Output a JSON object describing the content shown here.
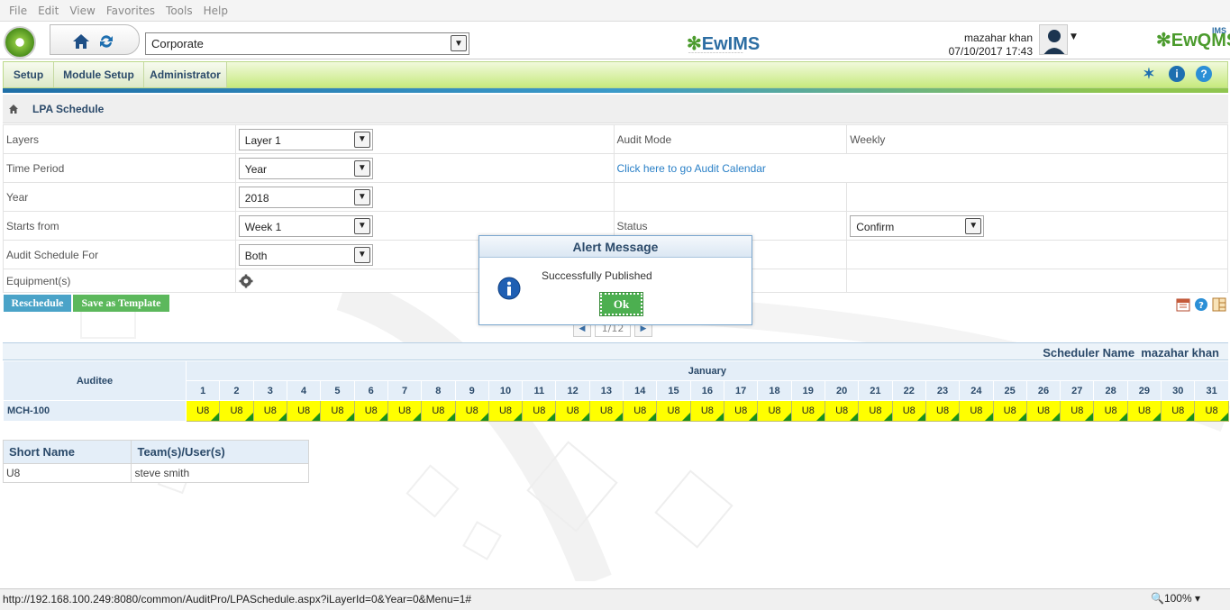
{
  "menu": [
    "File",
    "Edit",
    "View",
    "Favorites",
    "Tools",
    "Help"
  ],
  "header": {
    "org_select": "Corporate",
    "brand_center": "EwIMS",
    "brand_right": "EwQMS",
    "brand_right_super": "IMS",
    "user_name": "mazahar khan",
    "datetime": "07/10/2017 17:43"
  },
  "nav": {
    "tabs": [
      "Setup",
      "Module Setup",
      "Administrator"
    ]
  },
  "breadcrumb": {
    "title": "LPA Schedule"
  },
  "form": {
    "layers_label": "Layers",
    "layers_value": "Layer 1",
    "time_period_label": "Time Period",
    "time_period_value": "Year",
    "year_label": "Year",
    "year_value": "2018",
    "starts_from_label": "Starts from",
    "starts_from_value": "Week 1",
    "audit_schedule_for_label": "Audit Schedule For",
    "audit_schedule_for_value": "Both",
    "equipment_label": "Equipment(s)",
    "audit_mode_label": "Audit Mode",
    "audit_mode_value": "Weekly",
    "calendar_link": "Click here to go Audit Calendar",
    "status_label": "Status",
    "status_value": "Confirm"
  },
  "actions": {
    "reschedule": "Reschedule",
    "save_template": "Save as Template"
  },
  "pager": {
    "label": "1/12"
  },
  "scheduler": {
    "label": "Scheduler Name",
    "name": "mazahar khan"
  },
  "schedule": {
    "auditee_header": "Auditee",
    "month": "January",
    "days": [
      "1",
      "2",
      "3",
      "4",
      "5",
      "6",
      "7",
      "8",
      "9",
      "10",
      "11",
      "12",
      "13",
      "14",
      "15",
      "16",
      "17",
      "18",
      "19",
      "20",
      "21",
      "22",
      "23",
      "24",
      "25",
      "26",
      "27",
      "28",
      "29",
      "30",
      "31"
    ],
    "rows": [
      {
        "auditee": "MCH-100",
        "cells": [
          "U8",
          "U8",
          "U8",
          "U8",
          "U8",
          "U8",
          "U8",
          "U8",
          "U8",
          "U8",
          "U8",
          "U8",
          "U8",
          "U8",
          "U8",
          "U8",
          "U8",
          "U8",
          "U8",
          "U8",
          "U8",
          "U8",
          "U8",
          "U8",
          "U8",
          "U8",
          "U8",
          "U8",
          "U8",
          "U8",
          "U8"
        ]
      }
    ]
  },
  "legend": {
    "headers": [
      "Short Name",
      "Team(s)/User(s)"
    ],
    "rows": [
      [
        "U8",
        "steve smith"
      ]
    ]
  },
  "dialog": {
    "title": "Alert Message",
    "message": "Successfully Published",
    "ok": "Ok"
  },
  "statusbar": {
    "url": "http://192.168.100.249:8080/common/AuditPro/LPASchedule.aspx?iLayerId=0&Year=0&Menu=1#",
    "zoom": "100%"
  },
  "colors": {
    "scheduled_cell": "#ffff00",
    "nav_green": "#c7ea7e",
    "accent_blue": "#2b4a6a",
    "ok_green": "#4caf50",
    "reschedule_btn": "#4aa3c8"
  }
}
